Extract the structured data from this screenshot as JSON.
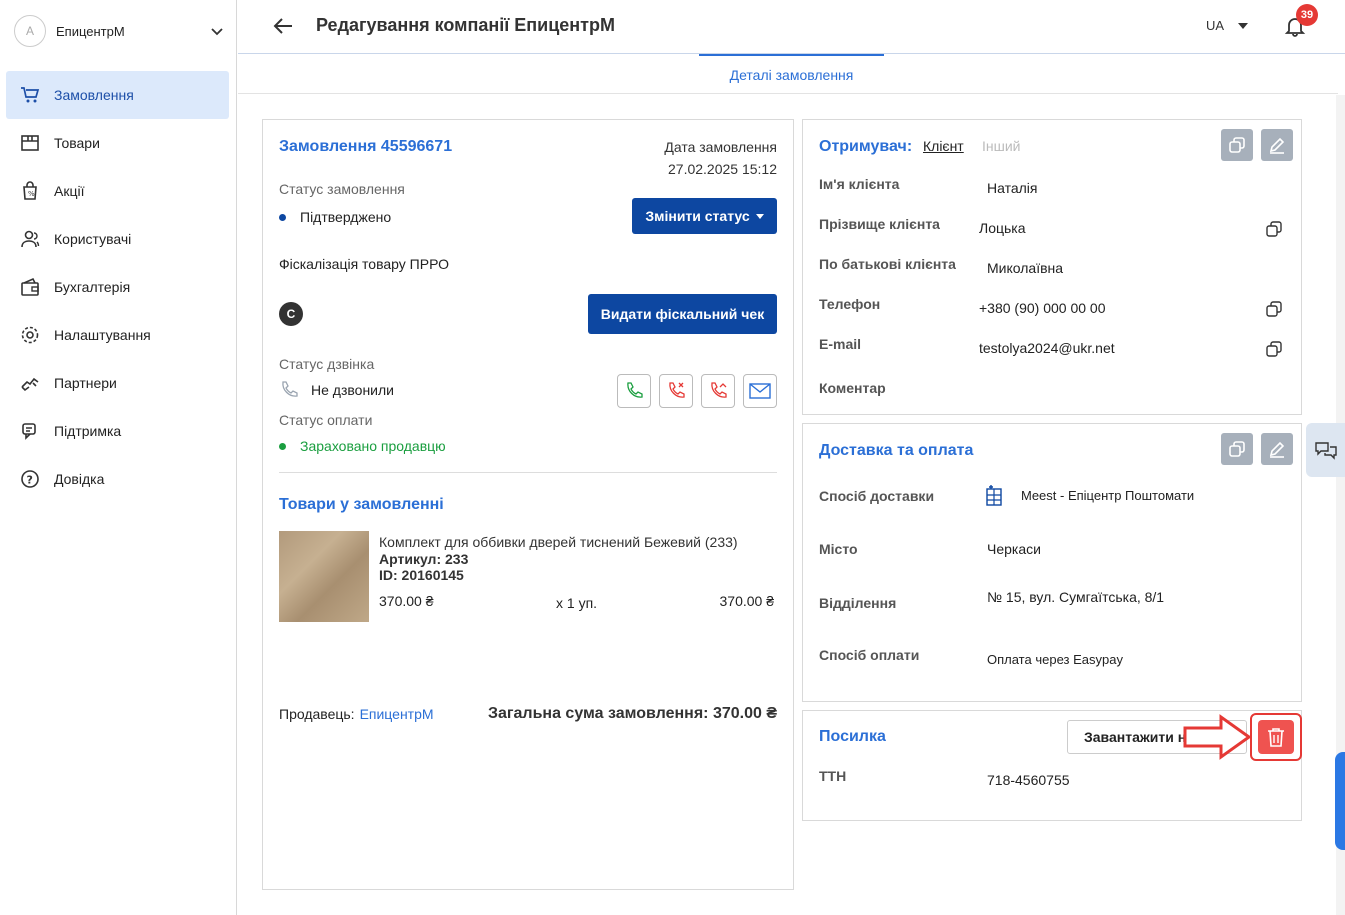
{
  "sidebar": {
    "avatar_letter": "A",
    "company_name": "ЕпицентрМ",
    "items": [
      {
        "label": "Замовлення",
        "icon": "cart-icon",
        "active": true
      },
      {
        "label": "Товари",
        "icon": "box-icon"
      },
      {
        "label": "Акції",
        "icon": "promo-bag-icon"
      },
      {
        "label": "Користувачі",
        "icon": "users-icon"
      },
      {
        "label": "Бухгалтерія",
        "icon": "wallet-icon"
      },
      {
        "label": "Налаштування",
        "icon": "gear-icon"
      },
      {
        "label": "Партнери",
        "icon": "handshake-icon"
      },
      {
        "label": "Підтримка",
        "icon": "support-chat-icon"
      },
      {
        "label": "Довідка",
        "icon": "help-icon"
      }
    ]
  },
  "header": {
    "title": "Редагування компанії ЕпицентрМ",
    "lang": "UA",
    "notifications": "39"
  },
  "tabs": {
    "details": "Деталі замовлення"
  },
  "order": {
    "title": "Замовлення 45596671",
    "date_label": "Дата замовлення",
    "date_value": "27.02.2025 15:12",
    "status_label": "Статус замовлення",
    "status_value": "Підтверджено",
    "change_status_btn": "Змінити статус",
    "fiscal_label": "Фіскалізація товару ПРРО",
    "fiscal_badge": "C",
    "fiscal_btn": "Видати фіскальний чек",
    "call_status_label": "Статус дзвінка",
    "call_status_value": "Не дзвонили",
    "payment_status_label": "Статус оплати",
    "payment_status_value": "Зараховано продавцю",
    "goods_title": "Товари у замовленні",
    "product": {
      "name": "Комплект для оббивки дверей тиснений Бежевий (233)",
      "article": "Артикул: 233",
      "id": "ID: 20160145",
      "price": "370.00 ₴",
      "qty": "х 1 уп.",
      "total": "370.00 ₴"
    },
    "seller_label": "Продавець:",
    "seller_value": "ЕпицентрМ",
    "total_label": "Загальна сума замовлення: 370.00 ₴"
  },
  "recipient": {
    "title": "Отримувач:",
    "tab_client": "Клієнт",
    "tab_other": "Інший",
    "rows": [
      {
        "label": "Ім'я клієнта",
        "value": "Наталія"
      },
      {
        "label": "Прізвище клієнта",
        "value": "Лоцька"
      },
      {
        "label": "По батькові клієнта",
        "value": "Миколаївна"
      },
      {
        "label": "Телефон",
        "value": "+380 (90) 000 00 00"
      },
      {
        "label": "E-mail",
        "value": "testolya2024@ukr.net"
      },
      {
        "label": "Коментар",
        "value": ""
      }
    ]
  },
  "delivery": {
    "title": "Доставка та оплата",
    "rows": [
      {
        "label": "Спосіб доставки",
        "value": "Meest - Епіцентр Поштомати"
      },
      {
        "label": "Місто",
        "value": "Черкаси"
      },
      {
        "label": "Відділення",
        "value": "№ 15, вул. Сумгаїтська, 8/1"
      },
      {
        "label": "Спосіб оплати",
        "value": "Оплата через Easypay"
      }
    ]
  },
  "parcel": {
    "title": "Посилка",
    "download_btn": "Завантажити накладну",
    "ttn_label": "ТТН",
    "ttn_value": "718-4560755"
  },
  "colors": {
    "accent": "#2b6fd6",
    "primary_btn": "#0d47a1",
    "danger": "#e53935",
    "success": "#1a9e3f"
  }
}
